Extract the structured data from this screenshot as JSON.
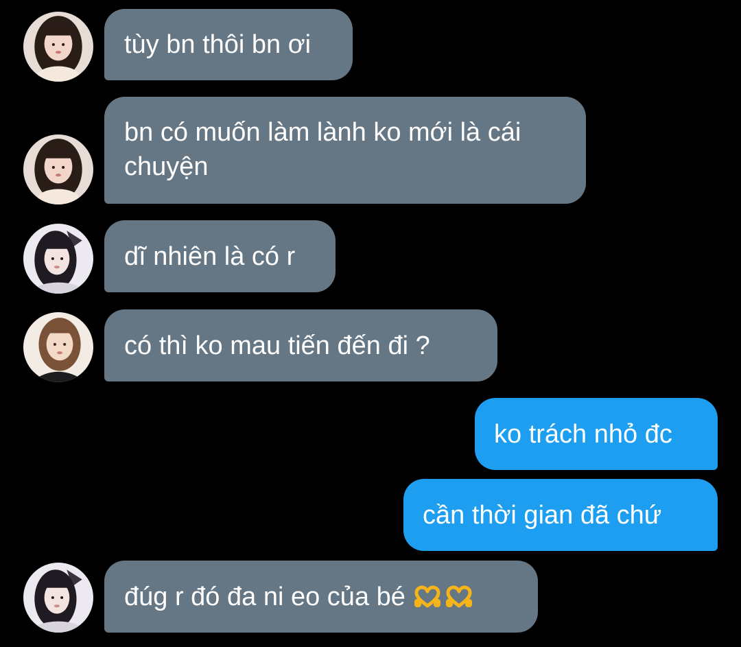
{
  "messages": [
    {
      "direction": "incoming",
      "avatar": "contact-a-avatar",
      "text": "tùy bn thôi bn ơi"
    },
    {
      "direction": "incoming",
      "avatar": "contact-a-avatar",
      "text": "bn có muốn làm lành ko mới là cái chuyện"
    },
    {
      "direction": "incoming",
      "avatar": "contact-b-avatar",
      "text": "dĩ nhiên là có r"
    },
    {
      "direction": "incoming",
      "avatar": "contact-c-avatar",
      "text": "có thì ko mau tiến đến đi ?"
    },
    {
      "direction": "outgoing",
      "text": "ko trách nhỏ đc"
    },
    {
      "direction": "outgoing",
      "text": "cần thời gian đã chứ"
    },
    {
      "direction": "incoming",
      "avatar": "contact-b-avatar",
      "text": "đúg r đó đa ni eo của bé",
      "emoji": [
        "heart-hands-emoji",
        "heart-hands-emoji"
      ]
    }
  ],
  "colors": {
    "background": "#000000",
    "incoming_bubble": "#657684",
    "outgoing_bubble": "#1d9ef0",
    "text": "#ffffff"
  }
}
